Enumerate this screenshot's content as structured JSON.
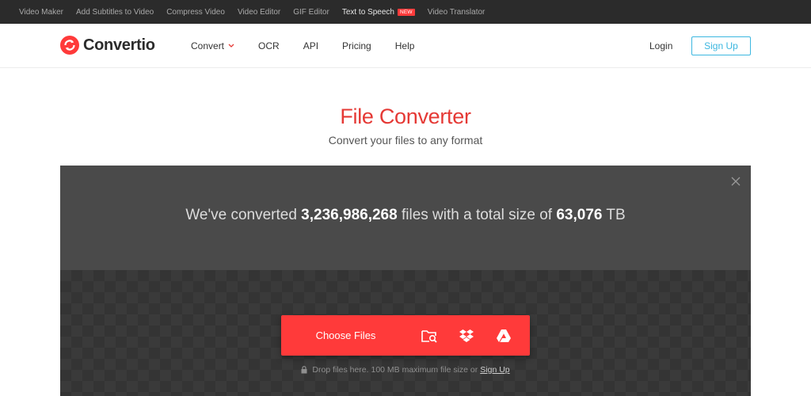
{
  "topbar": {
    "links": [
      {
        "label": "Video Maker"
      },
      {
        "label": "Add Subtitles to Video"
      },
      {
        "label": "Compress Video"
      },
      {
        "label": "Video Editor"
      },
      {
        "label": "GIF Editor"
      },
      {
        "label": "Text to Speech",
        "badge": "NEW"
      },
      {
        "label": "Video Translator"
      }
    ]
  },
  "header": {
    "logo_text": "Convertio",
    "nav": [
      {
        "label": "Convert"
      },
      {
        "label": "OCR"
      },
      {
        "label": "API"
      },
      {
        "label": "Pricing"
      },
      {
        "label": "Help"
      }
    ],
    "login_label": "Login",
    "signup_label": "Sign Up"
  },
  "hero": {
    "title": "File Converter",
    "subtitle": "Convert your files to any format"
  },
  "stats": {
    "prefix": "We've converted",
    "files_count": "3,236,986,268",
    "middle": "files with a total size of",
    "total_size": "63,076",
    "unit": "TB"
  },
  "upload": {
    "choose_label": "Choose Files",
    "icons": [
      "folder-search-icon",
      "dropbox-icon",
      "google-drive-icon"
    ],
    "drop_text": "Drop files here. 100 MB maximum file size or",
    "signup_link": "Sign Up"
  },
  "colors": {
    "brand_red": "#ff3a3a",
    "title_red": "#e53935",
    "signup_blue": "#3cb7e0",
    "topbar_bg": "#2b2b2b",
    "panel_bg": "#4a4a4a"
  }
}
